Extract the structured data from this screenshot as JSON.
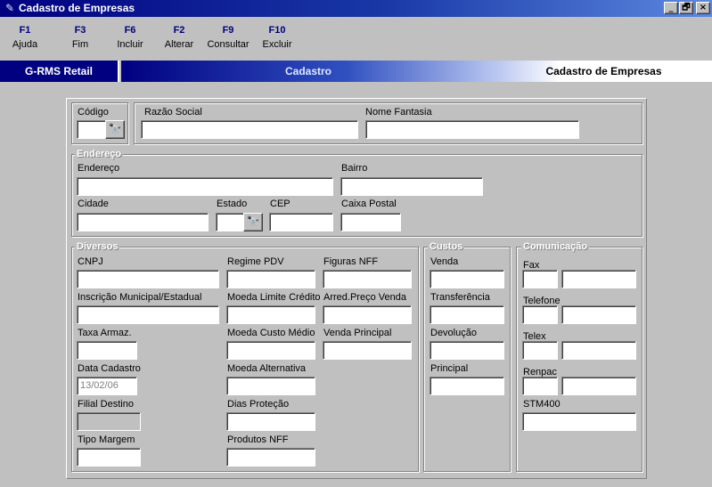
{
  "window": {
    "title": "Cadastro de Empresas",
    "app_icon": "pen-icon",
    "buttons": [
      "_",
      "🗗",
      "×"
    ]
  },
  "toolbar": {
    "keys": [
      {
        "key": "F1",
        "label": "Ajuda"
      },
      {
        "key": "F3",
        "label": "Fim"
      },
      {
        "key": "F6",
        "label": "Incluir"
      },
      {
        "key": "F2",
        "label": "Alterar"
      },
      {
        "key": "F9",
        "label": "Consultar"
      },
      {
        "key": "F10",
        "label": "Excluir"
      }
    ]
  },
  "header": {
    "app_name": "G-RMS Retail",
    "module": "Cadastro",
    "screen": "Cadastro de Empresas"
  },
  "colors": {
    "title_bar": "#000080",
    "function_key": "#000080",
    "background": "#c0c0c0"
  },
  "top": {
    "codigo": {
      "label": "Código",
      "value": ""
    },
    "razao_social": {
      "label": "Razão Social",
      "value": ""
    },
    "nome_fantasia": {
      "label": "Nome Fantasia",
      "value": ""
    }
  },
  "endereco": {
    "title": "Endereço",
    "endereco": {
      "label": "Endereço",
      "value": ""
    },
    "bairro": {
      "label": "Bairro",
      "value": ""
    },
    "cidade": {
      "label": "Cidade",
      "value": ""
    },
    "estado": {
      "label": "Estado",
      "value": ""
    },
    "cep": {
      "label": "CEP",
      "value": ""
    },
    "caixa_postal": {
      "label": "Caixa Postal",
      "value": ""
    }
  },
  "diversos": {
    "title": "Diversos",
    "cnpj": {
      "label": "CNPJ",
      "value": ""
    },
    "inscricao": {
      "label": "Inscrição Municipal/Estadual",
      "value": ""
    },
    "taxa_armaz": {
      "label": "Taxa Armaz.",
      "value": ""
    },
    "data_cadastro": {
      "label": "Data Cadastro",
      "value": "13/02/06"
    },
    "filial_destino": {
      "label": "Filial Destino",
      "value": ""
    },
    "tipo_margem": {
      "label": "Tipo Margem",
      "value": ""
    },
    "regime_pdv": {
      "label": "Regime PDV",
      "value": ""
    },
    "moeda_limite": {
      "label": "Moeda Limite Crédito",
      "value": ""
    },
    "moeda_custo": {
      "label": "Moeda Custo Médio",
      "value": ""
    },
    "moeda_alternativa": {
      "label": "Moeda Alternativa",
      "value": ""
    },
    "dias_protecao": {
      "label": "Dias Proteção",
      "value": ""
    },
    "produtos_nff": {
      "label": "Produtos NFF",
      "value": ""
    },
    "figuras_nff": {
      "label": "Figuras NFF",
      "value": ""
    },
    "arred_preco": {
      "label": "Arred.Preço Venda",
      "value": ""
    },
    "venda_principal": {
      "label": "Venda Principal",
      "value": ""
    }
  },
  "custos": {
    "title": "Custos",
    "venda": {
      "label": "Venda",
      "value": ""
    },
    "transferencia": {
      "label": "Transferência",
      "value": ""
    },
    "devolucao": {
      "label": "Devolução",
      "value": ""
    },
    "principal": {
      "label": "Principal",
      "value": ""
    }
  },
  "comunicacao": {
    "title": "Comunicação",
    "fax": {
      "label": "Fax",
      "ddd": "",
      "value": ""
    },
    "telefone": {
      "label": "Telefone",
      "ddd": "",
      "value": ""
    },
    "telex": {
      "label": "Telex",
      "ddd": "",
      "value": ""
    },
    "renpac": {
      "label": "Renpac",
      "ddd": "",
      "value": ""
    },
    "stm400": {
      "label": "STM400",
      "value": ""
    }
  }
}
